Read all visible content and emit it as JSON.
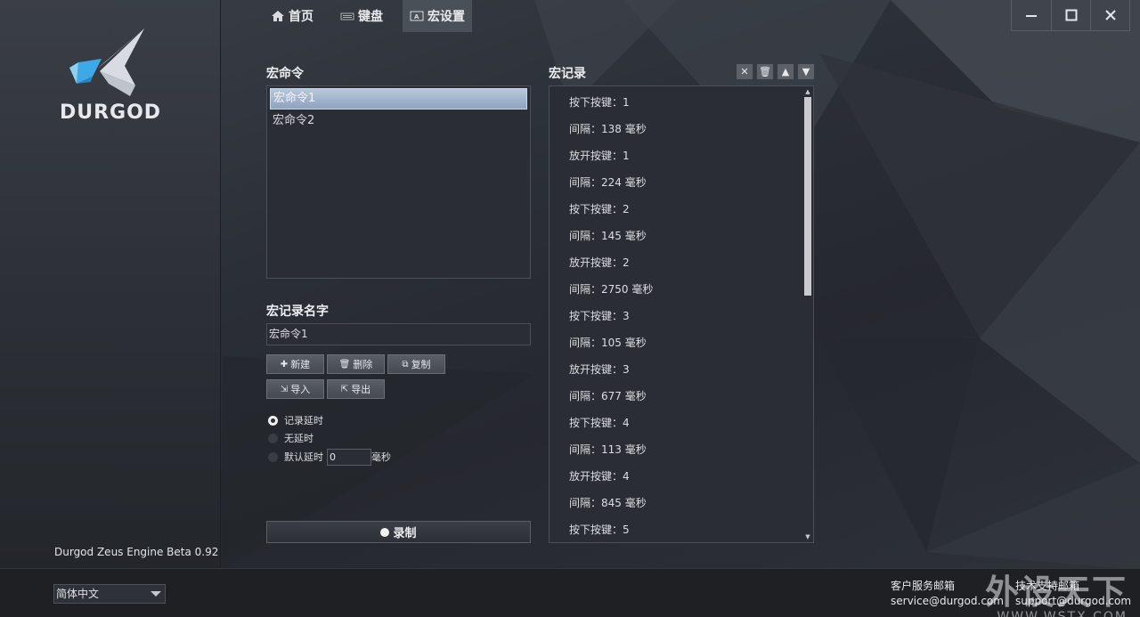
{
  "brand": {
    "logo_text": "DURGOD",
    "version": "Durgod Zeus Engine Beta 0.92"
  },
  "nav": {
    "tabs": [
      {
        "label": "首页",
        "icon": "home-icon"
      },
      {
        "label": "键盘",
        "icon": "keyboard-icon"
      },
      {
        "label": "宏设置",
        "icon": "macro-icon"
      }
    ],
    "active": "宏设置"
  },
  "macro_commands": {
    "title": "宏命令",
    "items": [
      "宏命令1",
      "宏命令2"
    ],
    "selected": "宏命令1"
  },
  "macro_name": {
    "title": "宏记录名字",
    "value": "宏命令1"
  },
  "buttons": {
    "new": "新建",
    "delete": "删除",
    "copy": "复制",
    "import": "导入",
    "export": "导出"
  },
  "delay_options": {
    "record": "记录延时",
    "none": "无延时",
    "default": "默认延时",
    "default_value": "0",
    "unit": "毫秒",
    "selected": "记录延时"
  },
  "record_button": "录制",
  "macro_record": {
    "title": "宏记录",
    "rows": [
      "按下按键：1",
      "间隔：138 毫秒",
      "放开按键：1",
      "间隔：224 毫秒",
      "按下按键：2",
      "间隔：145 毫秒",
      "放开按键：2",
      "间隔：2750 毫秒",
      "按下按键：3",
      "间隔：105 毫秒",
      "放开按键：3",
      "间隔：677 毫秒",
      "按下按键：4",
      "间隔：113 毫秒",
      "放开按键：4",
      "间隔：845 毫秒",
      "按下按键：5"
    ]
  },
  "footer": {
    "language": "简体中文",
    "customer_service_label": "客户服务邮箱",
    "customer_service_email": "service@durgod.com",
    "tech_support_label": "技术支持邮箱",
    "tech_support_email": "support@durgod.com"
  },
  "watermark": {
    "cn": "外设天下",
    "en": "WWW.WSTX.COM"
  },
  "colors": {
    "accent_selected": "#9fb3cc",
    "background": "#2a2e35",
    "footer": "#1e2024"
  }
}
